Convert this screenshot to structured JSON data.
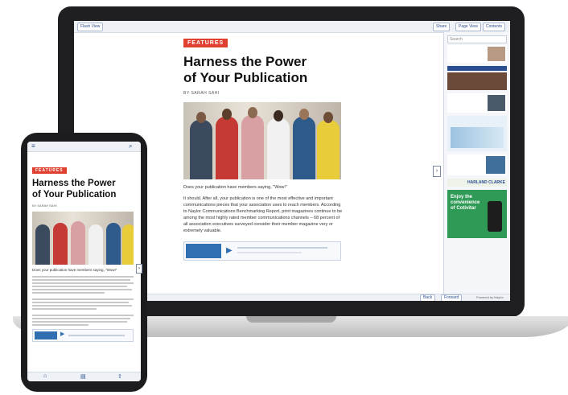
{
  "colors": {
    "accent_red": "#e0402f",
    "link_blue": "#2a4d8f",
    "toolbar": "#eef1f5"
  },
  "desktop": {
    "toolbar": {
      "left_button": "Flash View",
      "right_buttons": [
        "Share",
        "Page View",
        "Contents"
      ]
    },
    "article": {
      "tag": "FEATURES",
      "title_line1": "Harness the Power",
      "title_line2": "of Your Publication",
      "byline": "BY SARAH SAHI",
      "question": "Does your publication have members saying, \"Wow!\"",
      "paragraph": "It should. After all, your publication is one of the most effective and important communications pieces that your association uses to reach members. According to Naylor Communications Benchmarking Report, print magazines continue to be among the most highly rated member communications channels – 68 percent of all association executives surveyed consider their member magazine very or extremely valuable."
    },
    "sidebar": {
      "search_placeholder": "Search",
      "ads": [
        "HARLAND CLARKE",
        "Enjoy the convenience of Cotivitar"
      ]
    },
    "bottom": {
      "buttons": [
        "Back",
        "Forward"
      ],
      "credit": "Powered by Naylor"
    }
  },
  "mobile": {
    "tag": "FEATURES",
    "title_line1": "Harness the Power",
    "title_line2": "of Your Publication",
    "byline": "BY SARAH SAHI",
    "question": "Does your publication have members saying, \"Wow!\""
  },
  "icons": [
    "menu-icon",
    "search-icon",
    "play-icon",
    "chevron-right-icon",
    "chevron-left-icon",
    "home-icon",
    "share-icon"
  ]
}
